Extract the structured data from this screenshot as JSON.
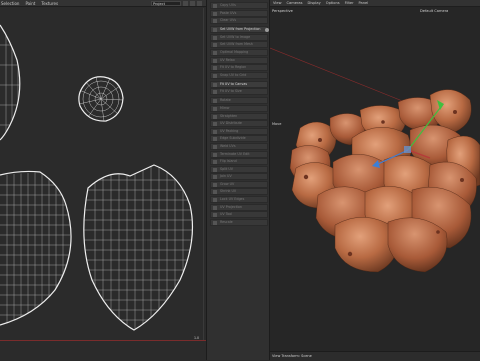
{
  "uv_editor": {
    "menu": [
      "Selection",
      "Paint",
      "Textures"
    ],
    "dropdown": "Project",
    "axis_label": "1.0"
  },
  "commands": {
    "items": [
      {
        "label": "Copy UVs",
        "active": false
      },
      {
        "label": "Paste UVs",
        "active": false
      },
      {
        "label": "Clear UVs",
        "active": false
      },
      {
        "label": "Set UVW from Projection",
        "active": true
      },
      {
        "label": "Set UVW to Image",
        "active": false
      },
      {
        "label": "Set UVW from Mesh",
        "active": false
      },
      {
        "label": "Optimal Mapping",
        "active": false
      },
      {
        "label": "UV Relax",
        "active": false
      },
      {
        "label": "Fit UV to Region",
        "active": false
      },
      {
        "label": "Snap UV to Grid",
        "active": false
      },
      {
        "label": "Fit UV to Canvas",
        "active": true
      },
      {
        "label": "Fit UV to Size",
        "active": false
      },
      {
        "label": "Rotate",
        "active": false
      },
      {
        "label": "Mirror",
        "active": false
      },
      {
        "label": "Straighten",
        "active": false
      },
      {
        "label": "UV Distribute",
        "active": false
      },
      {
        "label": "UV Packing",
        "active": false
      },
      {
        "label": "Edge Subdivide",
        "active": false
      },
      {
        "label": "Weld UVs",
        "active": false
      },
      {
        "label": "Terminate UV Edit",
        "active": false
      },
      {
        "label": "Flip Island",
        "active": false
      },
      {
        "label": "Split UV",
        "active": false
      },
      {
        "label": "Join UV",
        "active": false
      },
      {
        "label": "Grow UV",
        "active": false
      },
      {
        "label": "Shrink UV",
        "active": false
      },
      {
        "label": "Lock UV Edges",
        "active": false
      },
      {
        "label": "UV Projection",
        "active": false
      },
      {
        "label": "UV Tool",
        "active": false
      },
      {
        "label": "Rescale",
        "active": false
      }
    ]
  },
  "viewport": {
    "menu": [
      "View",
      "Cameras",
      "Display",
      "Options",
      "Filter",
      "Panel"
    ],
    "label_view": "Perspective",
    "label_camera": "Default Camera",
    "label_side": "Move",
    "label_bottom": "View Transform: Scene"
  },
  "colors": {
    "uv_line": "#e8e8e8",
    "axis_red": "#b63a3a",
    "gizmo_green": "#3fbf3f",
    "gizmo_blue": "#3d7fd6",
    "skin": "#c8764a"
  }
}
